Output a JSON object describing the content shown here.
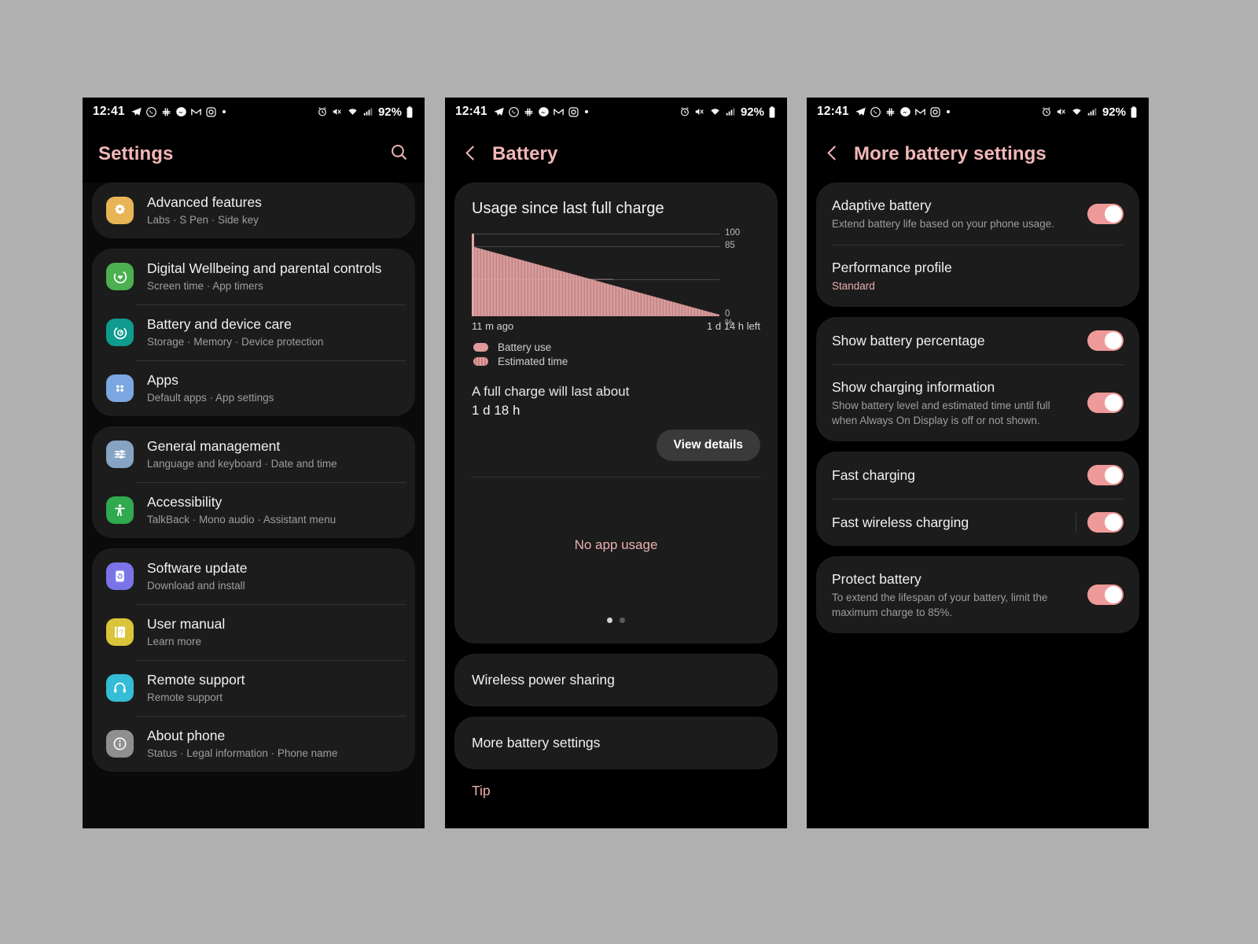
{
  "statusbar": {
    "time": "12:41",
    "battery_percent": "92%",
    "left_icons": [
      "telegram-icon",
      "whatsapp-icon",
      "slack-icon",
      "messenger-icon",
      "gmail-icon",
      "instagram-icon",
      "dot-icon"
    ],
    "right_icons": [
      "alarm-icon",
      "mute-icon",
      "wifi-icon",
      "signal-icon"
    ]
  },
  "colors": {
    "accent": "#f3b7b7",
    "toggle_on": "#ef9a9a",
    "card": "#1c1c1c",
    "page_bg": "#000000",
    "chart_fill": "#d99b9b"
  },
  "settings": {
    "title": "Settings",
    "search_icon": "search-icon",
    "groups": [
      {
        "items": [
          {
            "title": "Advanced features",
            "sub": "Labs  ·  S Pen  ·  Side key",
            "icon": "advanced-features-icon",
            "color": "#e8b455"
          }
        ]
      },
      {
        "items": [
          {
            "title": "Digital Wellbeing and parental controls",
            "sub": "Screen time  ·  App timers",
            "icon": "wellbeing-icon",
            "color": "#4caf50"
          },
          {
            "title": "Battery and device care",
            "sub": "Storage  ·  Memory  ·  Device protection",
            "icon": "device-care-icon",
            "color": "#0f9b8e"
          },
          {
            "title": "Apps",
            "sub": "Default apps  ·  App settings",
            "icon": "apps-icon",
            "color": "#7aa7e0"
          }
        ]
      },
      {
        "items": [
          {
            "title": "General management",
            "sub": "Language and keyboard  ·  Date and time",
            "icon": "general-management-icon",
            "color": "#86a3c4"
          },
          {
            "title": "Accessibility",
            "sub": "TalkBack  ·  Mono audio  ·  Assistant menu",
            "icon": "accessibility-icon",
            "color": "#30a94f"
          }
        ]
      },
      {
        "items": [
          {
            "title": "Software update",
            "sub": "Download and install",
            "icon": "software-update-icon",
            "color": "#7a74e8"
          },
          {
            "title": "User manual",
            "sub": "Learn more",
            "icon": "user-manual-icon",
            "color": "#d9c43a"
          },
          {
            "title": "Remote support",
            "sub": "Remote support",
            "icon": "remote-support-icon",
            "color": "#35bcd6"
          },
          {
            "title": "About phone",
            "sub": "Status  ·  Legal information  ·  Phone name",
            "icon": "about-phone-icon",
            "color": "#8f8f8f"
          }
        ]
      }
    ]
  },
  "battery": {
    "title": "Battery",
    "back_icon": "back-chevron-icon",
    "usage_heading": "Usage since last full charge",
    "axis": {
      "top": "100",
      "second": "85",
      "bottom": "0 %"
    },
    "time_start": "11 m ago",
    "time_end": "1 d 14 h left",
    "legend": [
      {
        "label": "Battery use",
        "style": "solid"
      },
      {
        "label": "Estimated time",
        "style": "striped"
      }
    ],
    "full_charge_line1": "A full charge will last about",
    "full_charge_line2": "1 d 18 h",
    "view_details": "View details",
    "no_app_usage": "No app usage",
    "page_dots": [
      "on",
      "off"
    ],
    "items": [
      "Wireless power sharing",
      "More battery settings"
    ],
    "tip": "Tip"
  },
  "chart_data": {
    "type": "area",
    "title": "Usage since last full charge",
    "xlabel": "",
    "ylabel": "%",
    "ylim": [
      0,
      100
    ],
    "yticks": [
      0,
      85,
      100
    ],
    "ytick_labels": [
      "0 %",
      "85",
      "100"
    ],
    "x_start_label": "11 m ago",
    "x_end_label": "1 d 14 h left",
    "grid": "horizontal-dotted-at-85",
    "series": [
      {
        "name": "Battery use",
        "style": "solid",
        "x": [
          0,
          1
        ],
        "values": [
          85,
          84
        ]
      },
      {
        "name": "Estimated time",
        "style": "striped",
        "x": [
          0,
          100
        ],
        "values": [
          85,
          0
        ]
      }
    ]
  },
  "more_battery": {
    "title": "More battery settings",
    "back_icon": "back-chevron-icon",
    "groups": [
      {
        "rows": [
          {
            "title": "Adaptive battery",
            "sub": "Extend battery life based on your phone usage.",
            "toggle": "on"
          },
          {
            "title": "Performance profile",
            "sub": "Standard",
            "sub_accent": true,
            "toggle": "none"
          }
        ]
      },
      {
        "rows": [
          {
            "title": "Show battery percentage",
            "sub": "",
            "toggle": "on"
          },
          {
            "title": "Show charging information",
            "sub": "Show battery level and estimated time until full when Always On Display is off or not shown.",
            "toggle": "on"
          }
        ]
      },
      {
        "rows": [
          {
            "title": "Fast charging",
            "sub": "",
            "toggle": "on"
          },
          {
            "title": "Fast wireless charging",
            "sub": "",
            "toggle": "on",
            "divider": true
          }
        ]
      },
      {
        "rows": [
          {
            "title": "Protect battery",
            "sub": "To extend the lifespan of your battery, limit the maximum charge to 85%.",
            "toggle": "on"
          }
        ]
      }
    ]
  }
}
